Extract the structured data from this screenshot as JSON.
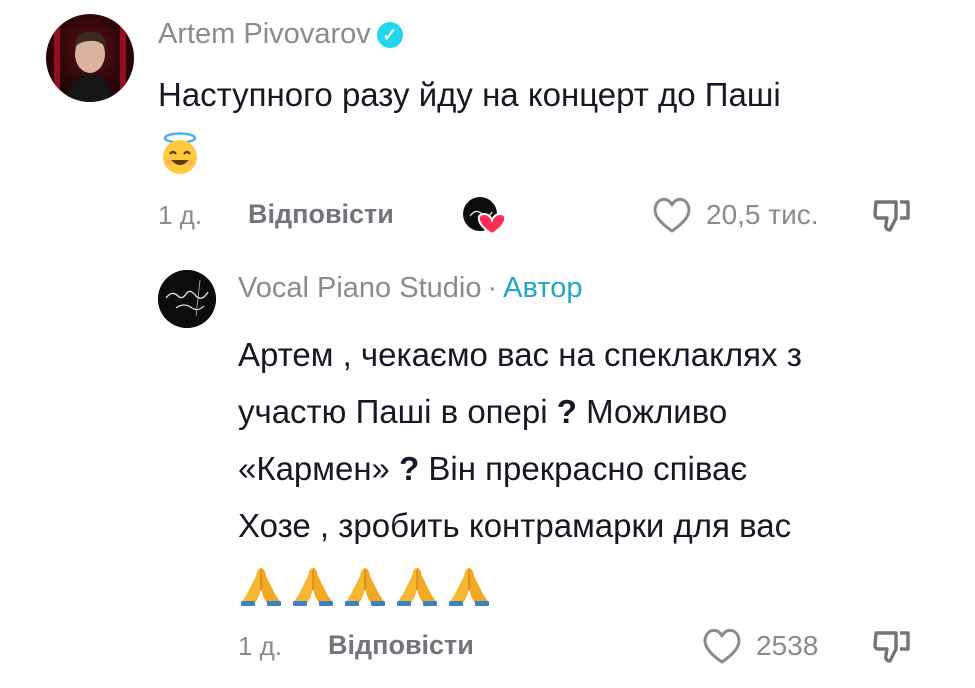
{
  "comment": {
    "author": "Artem Pivovarov",
    "text": "Наступного разу йду на концерт до Паші",
    "emoji": "smiling-face-with-halo",
    "time": "1 д.",
    "reply_label": "Відповісти",
    "likes": "20,5 тис."
  },
  "reply": {
    "author": "Vocal Piano Studio",
    "separator": "·",
    "author_badge": "Автор",
    "lines": [
      "Артем , чекаємо вас на спеклаклях з",
      "участю Паші в опері",
      "Можливо",
      "«Кармен»",
      "Він прекрасно співає",
      "Хозе , зробить контрамарки для вас"
    ],
    "marks": [
      "?",
      "?"
    ],
    "emoji_count": 5,
    "emoji": "folded-hands",
    "time": "1 д.",
    "reply_label": "Відповісти",
    "likes": "2538"
  },
  "colors": {
    "verified": "#20d5ec",
    "author_badge": "#1fa6c9",
    "like_heart": "#fe2c55"
  }
}
